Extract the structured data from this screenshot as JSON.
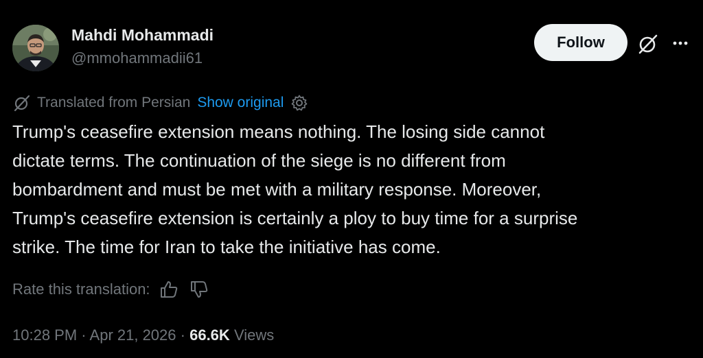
{
  "author": {
    "name": "Mahdi Mohammadi",
    "handle": "@mmohammadii61",
    "avatar_icon": "profile-photo"
  },
  "actions": {
    "follow_label": "Follow",
    "grok_icon": "grok-icon",
    "more_icon": "more-icon"
  },
  "translation": {
    "icon": "translate-icon",
    "label": "Translated from Persian",
    "show_original": "Show original",
    "settings_icon": "gear-icon"
  },
  "tweet": {
    "lines": [
      "Trump's ceasefire extension means nothing. The losing side cannot",
      "dictate terms. The continuation of the siege is no different from",
      "bombardment and must be met with a military response. Moreover,",
      "Trump's ceasefire extension is certainly a ploy to buy time for a surprise",
      "strike. The time for Iran to take the initiative has come."
    ]
  },
  "rating": {
    "label": "Rate this translation:",
    "thumbs_up_icon": "thumbs-up-icon",
    "thumbs_down_icon": "thumbs-down-icon"
  },
  "meta": {
    "time": "10:28 PM",
    "separator": "·",
    "date": "Apr 21, 2026",
    "views_count": "66.6K",
    "views_label": "Views"
  },
  "colors": {
    "background": "#000000",
    "text_primary": "#e7e9ea",
    "text_secondary": "#71767b",
    "link": "#1d9bf0",
    "follow_bg": "#eff3f4"
  }
}
